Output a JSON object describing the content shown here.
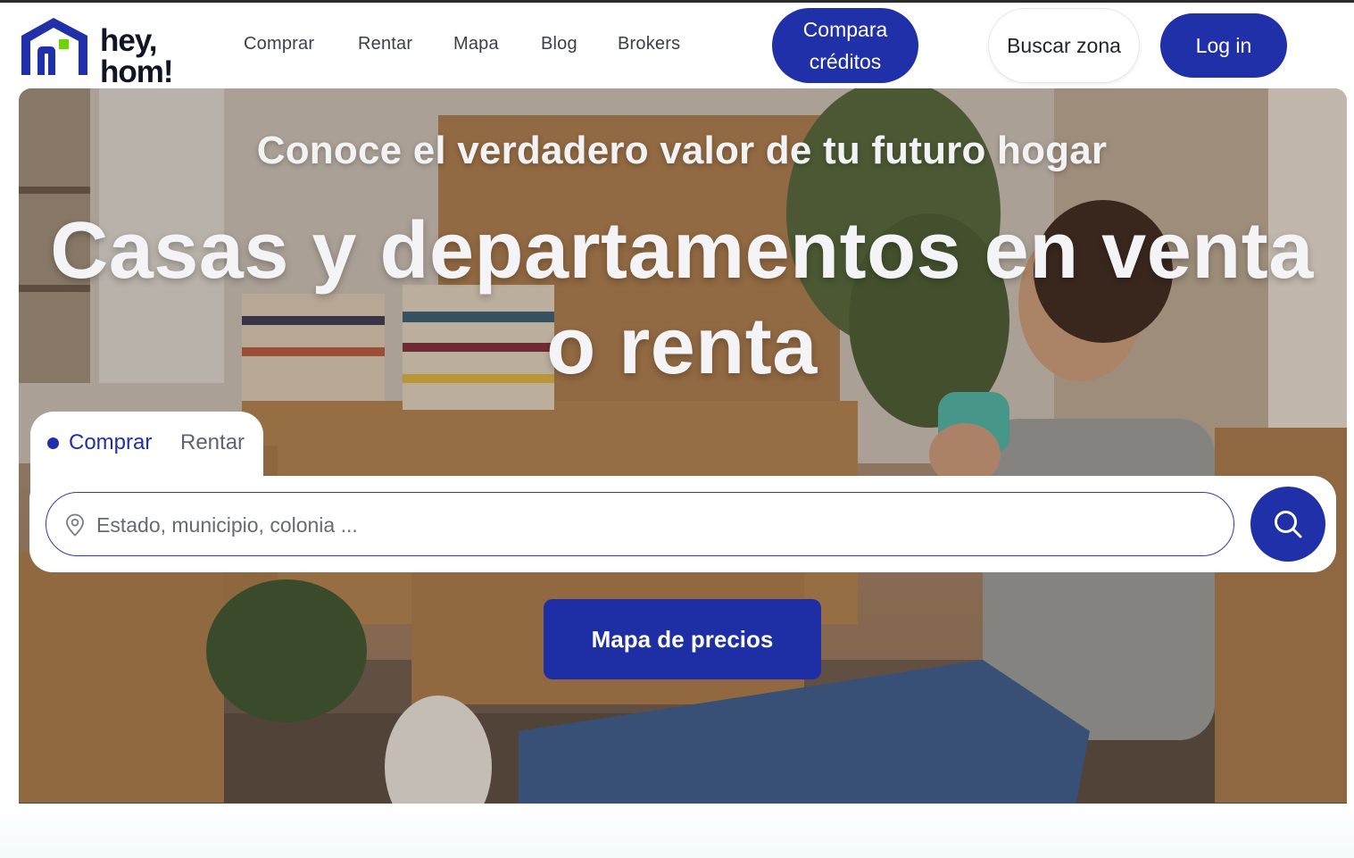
{
  "brand": {
    "logo_text": "hey,\nhom!",
    "primary_color": "#1f30a8",
    "accent_color": "#6dd400"
  },
  "nav": {
    "items": [
      "Comprar",
      "Rentar",
      "Mapa",
      "Blog",
      "Brokers"
    ]
  },
  "header_buttons": {
    "compara": "Compara\ncréditos",
    "buscar": "Buscar zona",
    "login": "Log in"
  },
  "hero": {
    "subtitle": "Conoce el verdadero valor de tu futuro hogar",
    "title": "Casas y departamentos en venta\no renta"
  },
  "search": {
    "tabs": [
      "Comprar",
      "Rentar"
    ],
    "active_tab": "Comprar",
    "placeholder": "Estado, municipio, colonia ...",
    "value": "",
    "icons": {
      "field": "map-pin-icon",
      "button": "search-icon"
    }
  },
  "cta": {
    "mapa_label": "Mapa de precios"
  }
}
